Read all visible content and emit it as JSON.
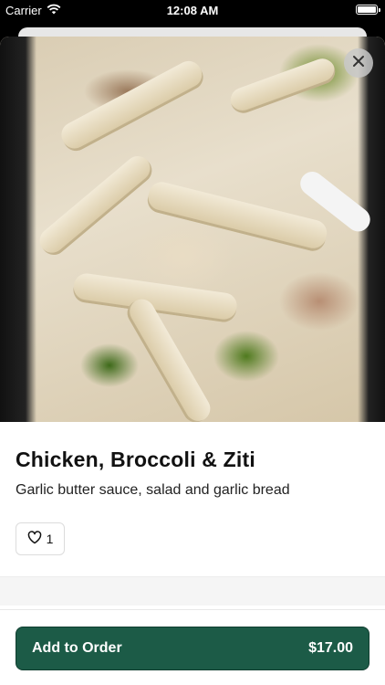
{
  "status_bar": {
    "carrier": "Carrier",
    "time": "12:08 AM"
  },
  "item": {
    "name": "Chicken, Broccoli & Ziti",
    "description": "Garlic butter sauce, salad and garlic bread",
    "likes": "1"
  },
  "order": {
    "button_label": "Add to Order",
    "price": "$17.00"
  },
  "colors": {
    "accent": "#1c5b47",
    "background": "#ffffff"
  },
  "icons": {
    "close": "close-icon",
    "like": "heart-icon",
    "wifi": "wifi-icon",
    "battery": "battery-icon"
  }
}
